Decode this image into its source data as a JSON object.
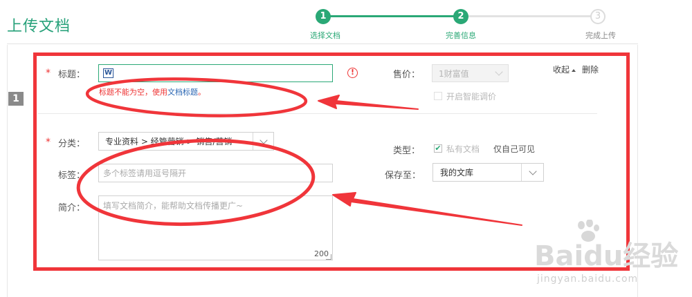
{
  "page": {
    "title": "上传文档"
  },
  "steps": [
    {
      "number": "1",
      "label": "选择文档",
      "state": "done"
    },
    {
      "number": "2",
      "label": "完善信息",
      "state": "current"
    },
    {
      "number": "3",
      "label": "完成上传",
      "state": "pending"
    }
  ],
  "doc": {
    "index_badge": "1",
    "actions": {
      "collapse": "收起",
      "delete": "删除"
    },
    "title_field": {
      "required_mark": "*",
      "label": "标题：",
      "file_icon": "W",
      "value": "",
      "error_prefix": "标题不能为空，使用",
      "error_link": "文档标题",
      "error_suffix": "。",
      "warning_icon": "!"
    },
    "price": {
      "label": "售价：",
      "selected": "1财富值",
      "smart_price_label": "开启智能调价"
    },
    "category": {
      "required_mark": "*",
      "label": "分类：",
      "selected": "专业资料 > 经管营销 > 销售/营销"
    },
    "type": {
      "label": "类型：",
      "option": "私有文档",
      "hint": "仅自己可见"
    },
    "tags": {
      "label": "标签：",
      "placeholder": "多个标签请用逗号隔开"
    },
    "save_to": {
      "label": "保存至：",
      "selected": "我的文库"
    },
    "summary": {
      "label": "简介：",
      "placeholder": "填写文档简介，能帮助文档传播更广~",
      "counter": "200"
    }
  },
  "watermark": {
    "brand": "Baidu经验",
    "url": "jingyan.baidu.com"
  },
  "colors": {
    "accent": "#2aa876",
    "error": "#e33333",
    "annotation": "#f0353a"
  }
}
